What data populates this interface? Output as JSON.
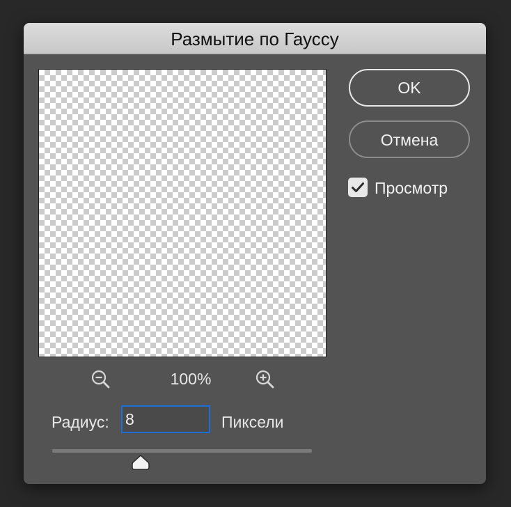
{
  "dialog": {
    "title": "Размытие по Гауссу"
  },
  "zoom": {
    "level": "100%",
    "zoom_out_icon": "zoom-out-icon",
    "zoom_in_icon": "zoom-in-icon"
  },
  "radius": {
    "label": "Радиус:",
    "value": "8",
    "unit": "Пиксели",
    "slider_fraction": 0.34
  },
  "buttons": {
    "ok_label": "OK",
    "cancel_label": "Отмена"
  },
  "preview_toggle": {
    "label": "Просмотр",
    "checked": true
  },
  "colors": {
    "dialog_bg": "#535353",
    "titlebar_bg": "#d2d2d2",
    "focus_border": "#1f6ed4"
  }
}
